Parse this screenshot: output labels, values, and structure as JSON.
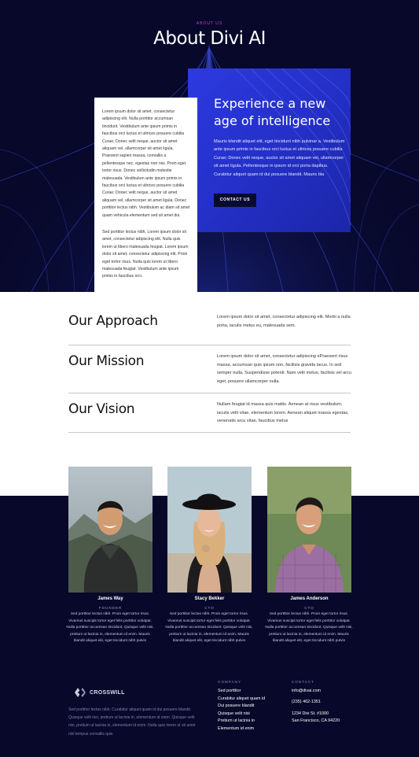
{
  "hero": {
    "eyebrow": "ABOUT US",
    "title": "About Divi AI"
  },
  "feature_card": {
    "heading": "Experience a new age of intelligence",
    "body": "Mauris blandit aliquet elit, eget tincidunt nibh pulvinar a. Vestibulum ante ipsum primis in faucibus orci luctus et ultrices posuere cubilia Curae; Donec velit neque, auctor sit amet aliquam vel, ullamcorper sit amet ligula. Pellentesque in ipsum id orci porta dapibus. Curabitur aliquet quam id dui posuere blandit. Mauris bla",
    "button_label": "CONTACT US"
  },
  "text_card": {
    "paragraph1": "Lorem ipsum dolor sit amet, consectetur adipiscing elit. Nulla porttitor accumsan tincidunt. Vestibulum ante ipsum primis in faucibus orci luctus et ultrices posuere cubilia Curae; Donec velit neque, auctor sit amet aliquam vel, ullamcorper sit amet ligula. Praesent sapien massa, convallis a pellentesque nec, egestas non nisi. Proin eget tortor risus. Donec sollicitudin molestie malesuada. Vestibulum ante ipsum primis in faucibus orci luctus et ultrices posuere cubilia Curae; Donec velit neque, auctor sit amet aliquam vel, ullamcorper sit amet ligula. Donec porttitor lectus nibh. Vestibulum ac diam sit amet quam vehicula elementum sed sit amet dui.",
    "paragraph2": "Sed porttitor lectus nibh. Lorem ipsum dolor sit amet, consectetur adipiscing elit. Nulla quis lorem ut libero malesuada feugiat. Lorem ipsum dolor sit amet, consectetur adipiscing elit. Proin eget tortor risus. Nulla quis lorem ut libero malesuada feugiat. Vestibulum ante ipsum primis in faucibus orci."
  },
  "sections": [
    {
      "title": "Our Approach",
      "text": "Lorem ipsum dolor sit amet, consectetur adipiscing elit. Morbi a nulla porta, iaculis metus eu, malesuada sem."
    },
    {
      "title": "Our Mission",
      "text": "Lorem ipsum dolor sit amet, consectetur adipiscing ePraesent risus massa, accumsan quis ipsum non, facilisis gravida lacus. In sed semper nulla, Suspendisse potenti. Nam velit metus, facilisis vel arcu eget, posuere ullamcorper nulla."
    },
    {
      "title": "Our Vision",
      "text": "Nullam feugiat id massa quis mattis. Aenean at risus vestibulum, iaculis velit vitae, elementum lorem. Aenean aliquet massa egestas, venenatis arcu vitae, faucibus metus"
    }
  ],
  "team": [
    {
      "name": "James Way",
      "role": "FOUNDER",
      "bio": "Sed porttitor lectus nibh. Proin eget tortor risus. Vivamus suscipit tortor eget felis porttitor volutpat. Nulla porttitor accumsan tincidunt. Quisque velit nisi, pretium ut lacinia in, elementum id enim. Mauris blandit aliquet elit, eget tincidunt nibh pulvin"
    },
    {
      "name": "Stacy Bekker",
      "role": "CTO",
      "bio": "Sed porttitor lectus nibh. Proin eget tortor risus. Vivamus suscipit tortor eget felis porttitor volutpat. Nulla porttitor accumsan tincidunt. Quisque velit nisi, pretium ut lacinia in, elementum id enim. Mauris blandit aliquet elit, eget tincidunt nibh pulvin"
    },
    {
      "name": "James Anderson",
      "role": "CTO",
      "bio": "Sed porttitor lectus nibh. Proin eget tortor risus. Vivamus suscipit tortor eget felis porttitor volutpat. Nulla porttitor accumsan tincidunt. Quisque velit nisi, pretium ut lacinia in, elementum id enim. Mauris blandit aliquet elit, eget tincidunt nibh pulvin"
    }
  ],
  "footer": {
    "logo_text": "CROSSWILL",
    "description": "Sed porttitor lectus nibh. Curabitur aliquet quam id dui posuere blandit. Quisque velit nisi, pretium ut lacinia in, elementum id enim. Quisque velit nisi, pretium ut lacinia in, elementum id enim. Nulla quis lorem ut sit amet nisl tempus convallis quis",
    "company_heading": "COMPANY",
    "company_links": [
      "Sed porttitor",
      "Curabitur aliquet quam id",
      "Dui posuere blandit",
      "Quisque velit nisi",
      "Pretium ut lacinia in",
      "Elementum id enim"
    ],
    "contact_heading": "CONTACT",
    "email": "info@divai.com",
    "phone": "(235) 462-1351",
    "address_line1": "1234 Divi St. #1000",
    "address_line2": "San Francisco, CA 94220"
  },
  "colors": {
    "navy": "#07082a",
    "accent_blue": "#2d3ae0",
    "eyebrow_pink": "#d33ae0"
  }
}
